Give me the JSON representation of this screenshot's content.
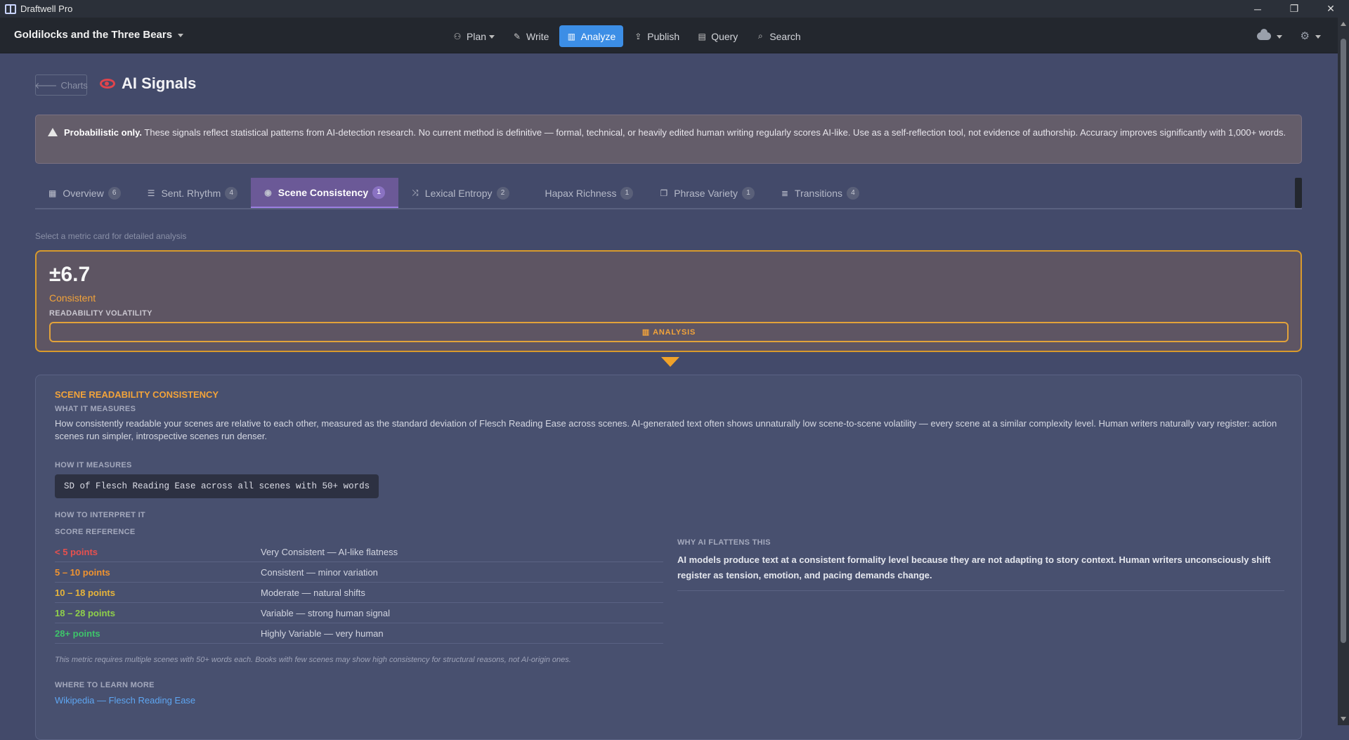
{
  "window": {
    "title": "Draftwell Pro",
    "controls": [
      "─",
      "❐",
      "✕"
    ]
  },
  "menubar": {
    "project": "Goldilocks and the Three Bears",
    "nav": [
      {
        "label": "Plan",
        "icon": "sitemap-icon",
        "glyph": "⚇",
        "dropdown": true,
        "active": false
      },
      {
        "label": "Write",
        "icon": "pencil-icon",
        "glyph": "✎",
        "active": false
      },
      {
        "label": "Analyze",
        "icon": "bar-chart-icon",
        "glyph": "▥",
        "active": true
      },
      {
        "label": "Publish",
        "icon": "upload-icon",
        "glyph": "⇪",
        "active": false
      },
      {
        "label": "Query",
        "icon": "table-icon",
        "glyph": "▤",
        "active": false
      },
      {
        "label": "Search",
        "icon": "search-icon",
        "glyph": "⌕",
        "active": false
      }
    ]
  },
  "page": {
    "back_label": "Charts",
    "title": "AI Signals"
  },
  "warning": {
    "bold": "Probabilistic only.",
    "text": " These signals reflect statistical patterns from AI-detection research. No current method is definitive — formal, technical, or heavily edited human writing regularly scores AI-like. Use as a self-reflection tool, not evidence of authorship. Accuracy improves significantly with 1,000+ words."
  },
  "tabs": [
    {
      "label": "Overview",
      "badge": "6",
      "icon": "grid-icon",
      "glyph": "▦",
      "active": false
    },
    {
      "label": "Sent. Rhythm",
      "badge": "4",
      "icon": "align-left-icon",
      "glyph": "☰",
      "active": false
    },
    {
      "label": "Scene Consistency",
      "badge": "1",
      "icon": "eye-icon",
      "glyph": "◉",
      "active": true
    },
    {
      "label": "Lexical Entropy",
      "badge": "2",
      "icon": "shuffle-icon",
      "glyph": "⤨",
      "active": false
    },
    {
      "label": "Hapax Richness",
      "badge": "1",
      "icon": "",
      "glyph": "",
      "active": false
    },
    {
      "label": "Phrase Variety",
      "badge": "1",
      "icon": "copy-icon",
      "glyph": "❐",
      "active": false
    },
    {
      "label": "Transitions",
      "badge": "4",
      "icon": "list-icon",
      "glyph": "≣",
      "active": false
    }
  ],
  "hint": "Select a metric card for detailed analysis",
  "metric": {
    "value": "±6.7",
    "status": "Consistent",
    "label": "READABILITY VOLATILITY",
    "button": "ANALYSIS"
  },
  "detail": {
    "title": "SCENE READABILITY CONSISTENCY",
    "what_h": "WHAT IT MEASURES",
    "what_text": "How consistently readable your scenes are relative to each other, measured as the standard deviation of Flesch Reading Ease across scenes. AI-generated text often shows unnaturally low scene-to-scene volatility — every scene at a similar complexity level. Human writers naturally vary register: action scenes run simpler, introspective scenes run denser.",
    "how_h": "HOW IT MEASURES",
    "formula": "SD of Flesch Reading Ease across all scenes with 50+ words",
    "interp_h": "HOW TO INTERPRET IT",
    "score_h": "SCORE REFERENCE",
    "scores": [
      {
        "range": "< 5 points",
        "desc": "Very Consistent — AI-like flatness",
        "color": "#e8504e"
      },
      {
        "range": "5 – 10 points",
        "desc": "Consistent — minor variation",
        "color": "#f0932f"
      },
      {
        "range": "10 – 18 points",
        "desc": "Moderate — natural shifts",
        "color": "#e6b43a"
      },
      {
        "range": "18 – 28 points",
        "desc": "Variable — strong human signal",
        "color": "#8fcf4a"
      },
      {
        "range": "28+ points",
        "desc": "Highly Variable — very human",
        "color": "#3ec46a"
      }
    ],
    "note": "This metric requires multiple scenes with 50+ words each. Books with few scenes may show high consistency for structural reasons, not AI-origin ones.",
    "why_h": "WHY AI FLATTENS THIS",
    "why_text": "AI models produce text at a consistent formality level because they are not adapting to story context. Human writers unconsciously shift register as tension, emotion, and pacing demands change.",
    "learn_h": "WHERE TO LEARN MORE",
    "link": "Wikipedia — Flesch Reading Ease"
  }
}
